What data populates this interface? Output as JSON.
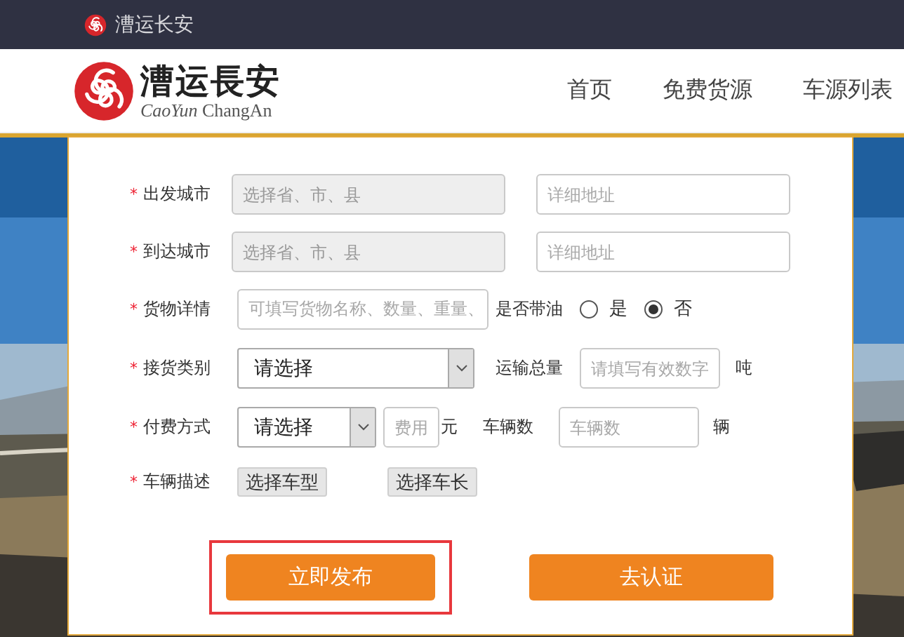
{
  "topbar": {
    "brand": "漕运长安"
  },
  "header": {
    "logo_title": "漕运長安",
    "logo_subtitle_italic": "CaoYun",
    "logo_subtitle": "ChangAn",
    "nav": [
      {
        "label": "首页"
      },
      {
        "label": "免费货源"
      },
      {
        "label": "车源列表"
      }
    ]
  },
  "form": {
    "rows": [
      {
        "marker": "*",
        "label": "出发城市",
        "items": [
          {
            "kind": "input",
            "placeholder": "选择省、市、县",
            "disabled": true
          },
          {
            "kind": "input",
            "placeholder": "详细地址",
            "disabled": false
          }
        ]
      },
      {
        "marker": "*",
        "label": "到达城市",
        "items": [
          {
            "kind": "input",
            "placeholder": "选择省、市、县",
            "disabled": true
          },
          {
            "kind": "input",
            "placeholder": "详细地址",
            "disabled": false
          }
        ]
      },
      {
        "marker": "*",
        "label": "货物详情",
        "items": [
          {
            "kind": "input",
            "placeholder": "可填写货物名称、数量、重量、",
            "disabled": false
          },
          {
            "kind": "text",
            "text": "是否带油"
          },
          {
            "kind": "radio",
            "label": "是",
            "selected": false
          },
          {
            "kind": "radio",
            "label": "否",
            "selected": true
          }
        ]
      },
      {
        "marker": "*",
        "label": "接货类别",
        "items": [
          {
            "kind": "select",
            "value": "请选择"
          },
          {
            "kind": "text",
            "text": "运输总量"
          },
          {
            "kind": "input",
            "placeholder": "请填写有效数字",
            "disabled": false
          },
          {
            "kind": "text",
            "text": "吨"
          }
        ]
      },
      {
        "marker": "*",
        "label": "付费方式",
        "items": [
          {
            "kind": "select",
            "value": "请选择"
          },
          {
            "kind": "input",
            "placeholder": "费用",
            "disabled": false
          },
          {
            "kind": "text",
            "text": "元"
          },
          {
            "kind": "text",
            "text": "车辆数"
          },
          {
            "kind": "input",
            "placeholder": "车辆数",
            "disabled": false
          },
          {
            "kind": "text",
            "text": "辆"
          }
        ]
      },
      {
        "marker": "*",
        "label": "车辆描述",
        "items": [
          {
            "kind": "button",
            "label": "选择车型"
          },
          {
            "kind": "button",
            "label": "选择车长"
          }
        ]
      }
    ],
    "actions": [
      {
        "label": "立即发布",
        "highlighted": true
      },
      {
        "label": "去认证",
        "highlighted": false
      }
    ]
  }
}
